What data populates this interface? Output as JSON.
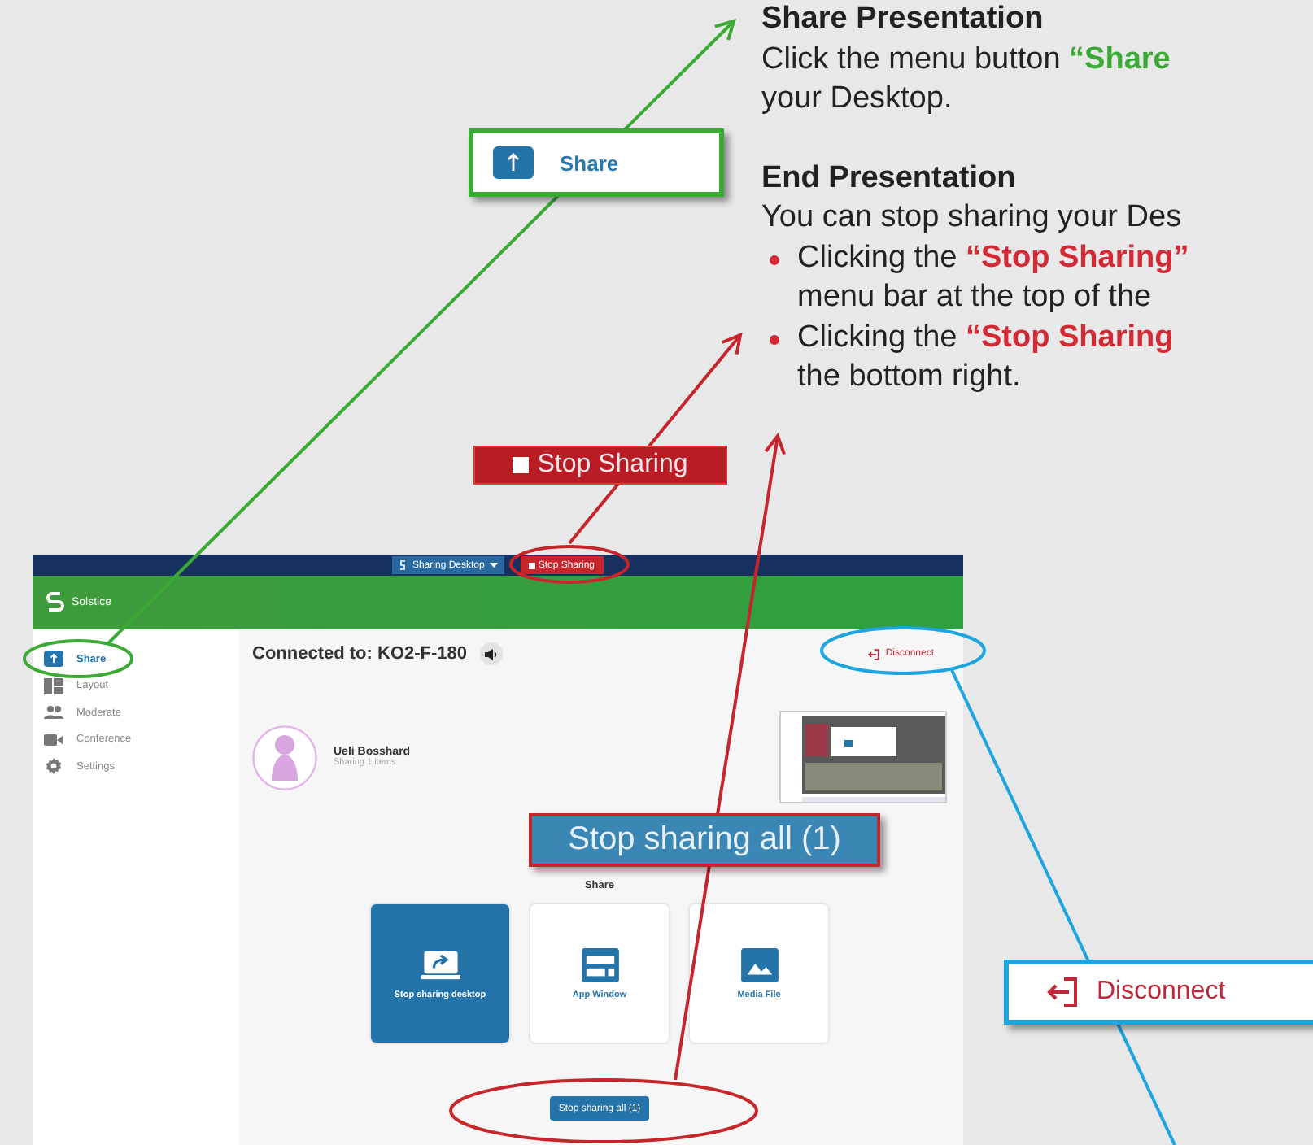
{
  "instructions": [
    {
      "kind": "heading",
      "text": "Share Presentation"
    },
    {
      "kind": "line",
      "text": "Click the menu button ",
      "highlight": "“Share",
      "color": "#3aaa35"
    },
    {
      "kind": "line",
      "text": "your Desktop."
    },
    {
      "kind": "heading",
      "text": "End Presentation"
    },
    {
      "kind": "line",
      "text": "You can stop sharing your Des"
    },
    {
      "kind": "bullet",
      "text": "Clicking the ",
      "highlight": "“Stop Sharing”",
      "color": "#d42a35"
    },
    {
      "kind": "continuation",
      "text": "menu bar at the top of the"
    },
    {
      "kind": "bullet",
      "text": "Clicking the ",
      "highlight": "“Stop Sharing",
      "color": "#d42a35"
    },
    {
      "kind": "continuation",
      "text": "the bottom right."
    }
  ],
  "app": {
    "top_bar": {
      "source": "Sharing Desktop",
      "stop_button": "Stop Sharing"
    },
    "brand": "Solstice",
    "nav": [
      {
        "kind": "share",
        "label": "Share",
        "selected": true
      },
      {
        "kind": "layout",
        "label": "Layout",
        "selected": false
      },
      {
        "kind": "moderate",
        "label": "Moderate",
        "selected": false
      },
      {
        "kind": "conference",
        "label": "Conference",
        "selected": false
      },
      {
        "kind": "settings",
        "label": "Settings",
        "selected": false
      }
    ],
    "connected": "Connected to: KO2-F-180",
    "disconnect": "Disconnect",
    "user": {
      "name": "Ueli Bosshard",
      "status": "Sharing 1 items"
    },
    "share_heading": "Share",
    "tiles": [
      {
        "kind": "desktop",
        "label": "Stop sharing desktop",
        "selected": true
      },
      {
        "kind": "app",
        "label": "App Window",
        "selected": false
      },
      {
        "kind": "media",
        "label": "Media File",
        "selected": false
      }
    ],
    "stop_all": "Stop sharing all (1)"
  },
  "callouts": [
    {
      "kind": "share",
      "label": "Share"
    },
    {
      "kind": "stop",
      "label": "Stop Sharing"
    },
    {
      "kind": "stop_all",
      "label": "Stop sharing all (1)"
    },
    {
      "kind": "disconnect",
      "label": "Disconnect"
    }
  ]
}
